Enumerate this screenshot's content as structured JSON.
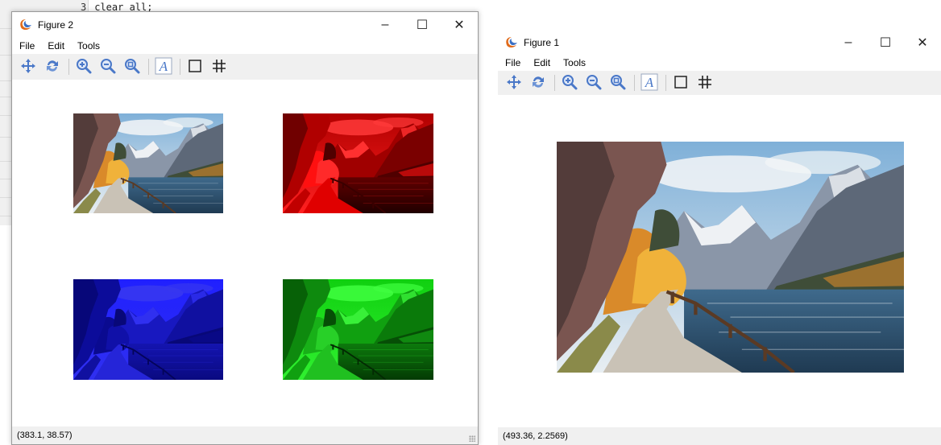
{
  "background_editor": {
    "line_number": "3",
    "code_text": "clear all;"
  },
  "figure2": {
    "title": "Figure 2",
    "menu": [
      "File",
      "Edit",
      "Tools"
    ],
    "toolbar": [
      "pan-icon",
      "rotate-icon",
      "zoom-in-icon",
      "zoom-out-icon",
      "zoom-extent-icon",
      "insert-text-icon",
      "draw-rectangle-icon",
      "toggle-grid-icon"
    ],
    "status": "(383.1, 38.57)",
    "subplots": [
      {
        "name": "original-image",
        "tint": "original"
      },
      {
        "name": "red-channel-image",
        "tint": "red"
      },
      {
        "name": "blue-channel-image",
        "tint": "blue"
      },
      {
        "name": "green-channel-image",
        "tint": "green"
      }
    ]
  },
  "figure1": {
    "title": "Figure 1",
    "menu": [
      "File",
      "Edit",
      "Tools"
    ],
    "toolbar": [
      "pan-icon",
      "rotate-icon",
      "zoom-in-icon",
      "zoom-out-icon",
      "zoom-extent-icon",
      "insert-text-icon",
      "draw-rectangle-icon",
      "toggle-grid-icon"
    ],
    "status": "(493.36, 2.2569)"
  },
  "window_controls": {
    "minimize": "–",
    "maximize": "☐",
    "close": "✕"
  },
  "colors": {
    "toolbar_bg": "#f0f0f0",
    "icon_blue": "#4a78c8",
    "logo_orange": "#e06a1a",
    "logo_blue": "#3a6fc4"
  }
}
